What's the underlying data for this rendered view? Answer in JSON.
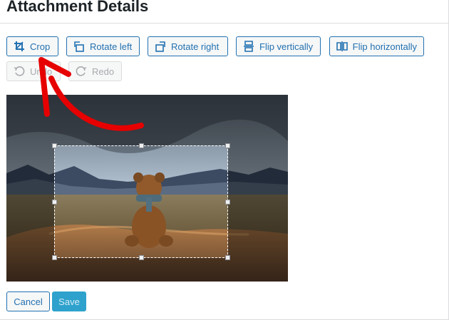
{
  "title": "Attachment Details",
  "toolbar": {
    "crop": "Crop",
    "rotate_left": "Rotate left",
    "rotate_right": "Rotate right",
    "flip_vertically": "Flip vertically",
    "flip_horizontally": "Flip horizontally",
    "undo": "Undo",
    "redo": "Redo"
  },
  "footer": {
    "cancel": "Cancel",
    "save": "Save"
  },
  "colors": {
    "accent": "#2271b1",
    "primary_disabled": "#2ea2cc",
    "annotation_arrow": "#e60000"
  },
  "icons": [
    "crop-icon",
    "rotate-left-icon",
    "rotate-right-icon",
    "flip-vertical-icon",
    "flip-horizontal-icon",
    "undo-icon",
    "redo-icon"
  ]
}
